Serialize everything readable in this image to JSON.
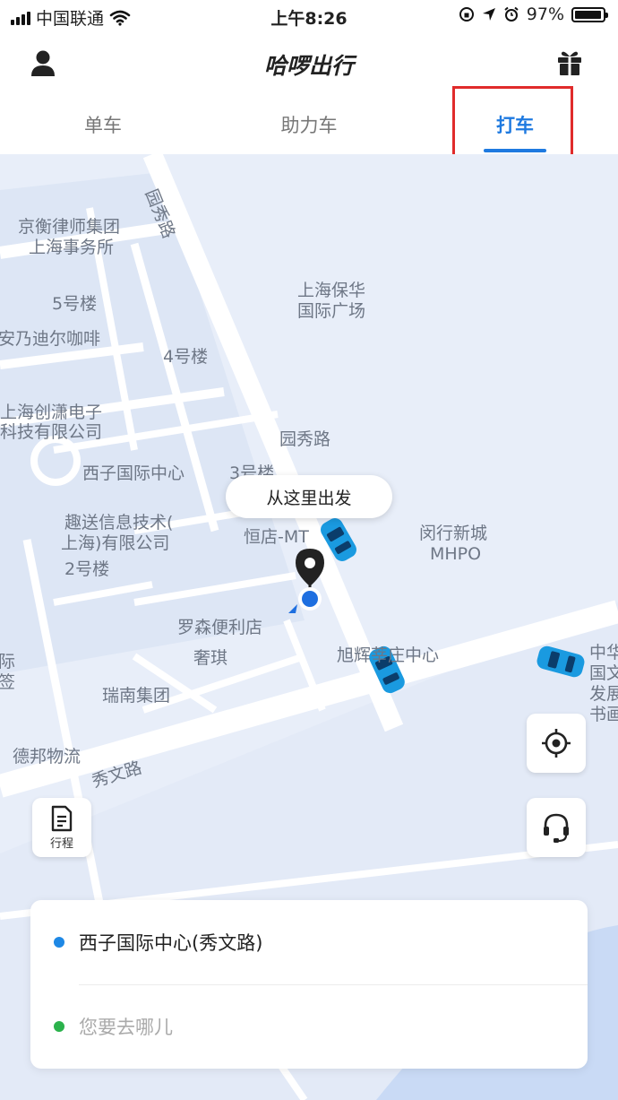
{
  "status_bar": {
    "carrier": "中国联通",
    "time": "上午8:26",
    "battery_text": "97%",
    "battery_level": 0.97
  },
  "header": {
    "title": "哈啰出行",
    "profile_icon": "user-icon",
    "gift_icon": "gift-icon"
  },
  "tabs": [
    {
      "label": "单车",
      "active": false
    },
    {
      "label": "助力车",
      "active": false
    },
    {
      "label": "打车",
      "active": true
    }
  ],
  "map": {
    "labels": [
      "园秀路",
      "京衡律师集团",
      "上海事务所",
      "5号楼",
      "安乃迪尔咖啡",
      "上海保华",
      "国际广场",
      "4号楼",
      "上海创潇电子",
      "科技有限公司",
      "园秀路",
      "西子国际中心",
      "3号楼",
      "趣送信息技术(",
      "上海)有限公司",
      "2号楼",
      "恒店-MT",
      "闵行新城",
      "MHPO",
      "罗森便利店",
      "奢琪",
      "旭辉莘庄中心",
      "瑞南集团",
      "德邦物流",
      "秀文路",
      "中华",
      "国文",
      "发展",
      "书画",
      "际",
      "签"
    ],
    "pickup_bubble": "从这里出发",
    "trip_button": "行程",
    "locate_icon": "locate-icon",
    "service_icon": "headset-icon"
  },
  "card": {
    "origin": "西子国际中心(秀文路)",
    "destination_placeholder": "您要去哪儿"
  },
  "colors": {
    "accent": "#1f7ae0",
    "origin_dot": "#1e88e5",
    "destination_dot": "#2bb24c",
    "highlight": "#e02b2b"
  }
}
